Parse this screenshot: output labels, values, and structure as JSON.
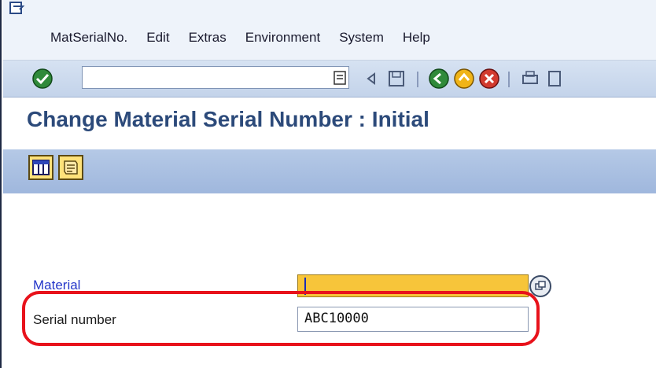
{
  "menubar": {
    "items": [
      "MatSerialNo.",
      "Edit",
      "Extras",
      "Environment",
      "System",
      "Help"
    ]
  },
  "toolbar": {
    "command_value": "",
    "icons": [
      "enter-icon",
      "command-dropdown-icon",
      "back-arrow-icon",
      "save-icon",
      "back-icon",
      "exit-icon",
      "cancel-icon",
      "print-icon",
      "find-icon"
    ]
  },
  "title": {
    "text": "Change Material Serial Number : Initial"
  },
  "app_toolbar": {
    "icons": [
      "table-icon",
      "document-icon"
    ]
  },
  "form": {
    "material_label": "Material",
    "material_value": "",
    "serial_label": "Serial number",
    "serial_value": "ABC10000"
  },
  "colors": {
    "highlight": "#e8121b",
    "required_field": "#f7c53a",
    "title": "#2c4a7a"
  }
}
